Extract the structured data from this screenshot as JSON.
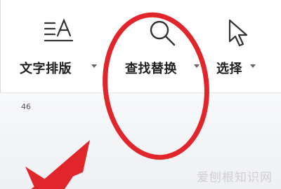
{
  "ribbon": {
    "tools": [
      {
        "label": "文字排版",
        "icon": "text-typesetting-icon"
      },
      {
        "label": "查找替换",
        "icon": "magnifier-icon"
      },
      {
        "label": "选择",
        "icon": "cursor-arrow-icon"
      }
    ]
  },
  "document": {
    "page_marker": "46"
  },
  "annotations": {
    "highlight_color": "#e0262b",
    "arrow_color": "#e0262b"
  },
  "watermark": {
    "text": "爱刨根知识网"
  }
}
